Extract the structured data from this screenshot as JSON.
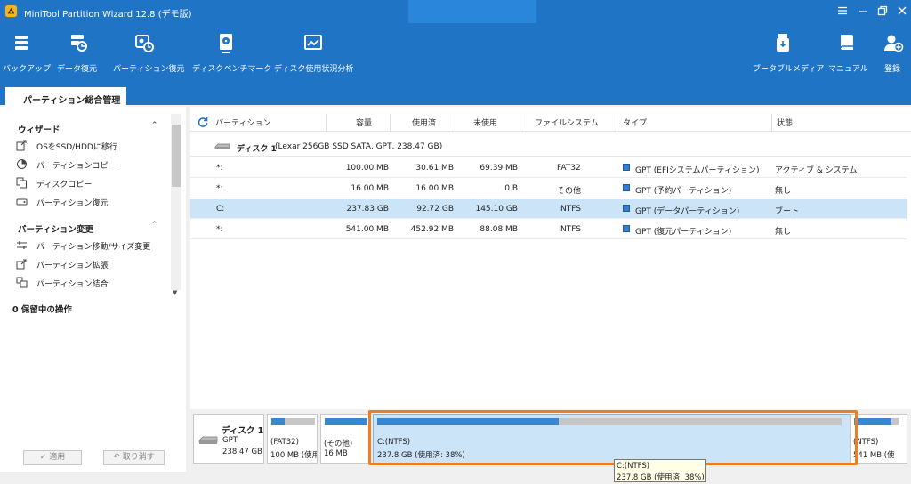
{
  "window": {
    "title": "MiniTool Partition Wizard 12.8 (デモ版)"
  },
  "toolbar": {
    "left": [
      {
        "icon": "backup-icon",
        "label": "バックアップ"
      },
      {
        "icon": "data-recovery-icon",
        "label": "データ復元"
      },
      {
        "icon": "partition-recovery-icon",
        "label": "パーティション復元"
      },
      {
        "icon": "disk-benchmark-icon",
        "label": "ディスクベンチマーク"
      },
      {
        "icon": "disk-usage-icon",
        "label": "ディスク使用状況分析"
      }
    ],
    "right": [
      {
        "icon": "bootable-media-icon",
        "label": "ブータブルメディア"
      },
      {
        "icon": "manual-icon",
        "label": "マニュアル"
      },
      {
        "icon": "register-icon",
        "label": "登録"
      }
    ]
  },
  "tab": {
    "label": "パーティション総合管理"
  },
  "sidebar": {
    "wizard_title": "ウィザード",
    "wizard_items": [
      {
        "icon": "migrate-os-icon",
        "label": "OSをSSD/HDDに移行"
      },
      {
        "icon": "copy-partition-icon",
        "label": "パーティションコピー"
      },
      {
        "icon": "copy-disk-icon",
        "label": "ディスクコピー"
      },
      {
        "icon": "partition-recovery-icon",
        "label": "パーティション復元"
      }
    ],
    "change_title": "パーティション変更",
    "change_items": [
      {
        "icon": "move-resize-icon",
        "label": "パーティション移動/サイズ変更"
      },
      {
        "icon": "extend-partition-icon",
        "label": "パーティション拡張"
      },
      {
        "icon": "merge-partition-icon",
        "label": "パーティション結合"
      }
    ],
    "pending": "0 保留中の操作",
    "apply_label": "✓ 適用",
    "undo_label": "↶ 取り消す"
  },
  "table": {
    "headers": [
      "パーティション",
      "容量",
      "使用済",
      "未使用",
      "ファイルシステム",
      "タイプ",
      "状態"
    ],
    "disk_label": "ディスク 1",
    "disk_detail": "(Lexar 256GB SSD SATA, GPT, 238.47 GB)",
    "rows": [
      {
        "partition": "*:",
        "capacity": "100.00 MB",
        "used": "30.61 MB",
        "unused": "69.39 MB",
        "fs": "FAT32",
        "type": "GPT (EFIシステムパーティション)",
        "status": "アクティブ & システム"
      },
      {
        "partition": "*:",
        "capacity": "16.00 MB",
        "used": "16.00 MB",
        "unused": "0 B",
        "fs": "その他",
        "type": "GPT (予約パーティション)",
        "status": "無し"
      },
      {
        "partition": "C:",
        "capacity": "237.83 GB",
        "used": "92.72 GB",
        "unused": "145.10 GB",
        "fs": "NTFS",
        "type": "GPT (データパーティション)",
        "status": "ブート"
      },
      {
        "partition": "*:",
        "capacity": "541.00 MB",
        "used": "452.92 MB",
        "unused": "88.08 MB",
        "fs": "NTFS",
        "type": "GPT (復元パーティション)",
        "status": "無し"
      }
    ]
  },
  "disk_map": {
    "disk_name": "ディスク 1",
    "disk_scheme": "GPT",
    "disk_size": "238.47 GB",
    "blocks": [
      {
        "name": "(FAT32)",
        "size": "100 MB (使用",
        "used_fraction": 0.31
      },
      {
        "name": "(その他)",
        "size": "16 MB",
        "used_fraction": 1.0
      },
      {
        "name": "C:(NTFS)",
        "size": "237.8 GB (使用済: 38%)",
        "used_fraction": 0.39
      },
      {
        "name": "(NTFS)",
        "size": "541 MB (使",
        "used_fraction": 0.84
      }
    ]
  },
  "tooltip": {
    "line1": "C:(NTFS)",
    "line2": "237.8 GB (使用済: 38%)"
  },
  "colors": {
    "header_bg": "#1f74c6",
    "selected_row": "#cce4f7",
    "highlight_border": "#ef7d22",
    "usage_fill": "#3c86d0"
  }
}
